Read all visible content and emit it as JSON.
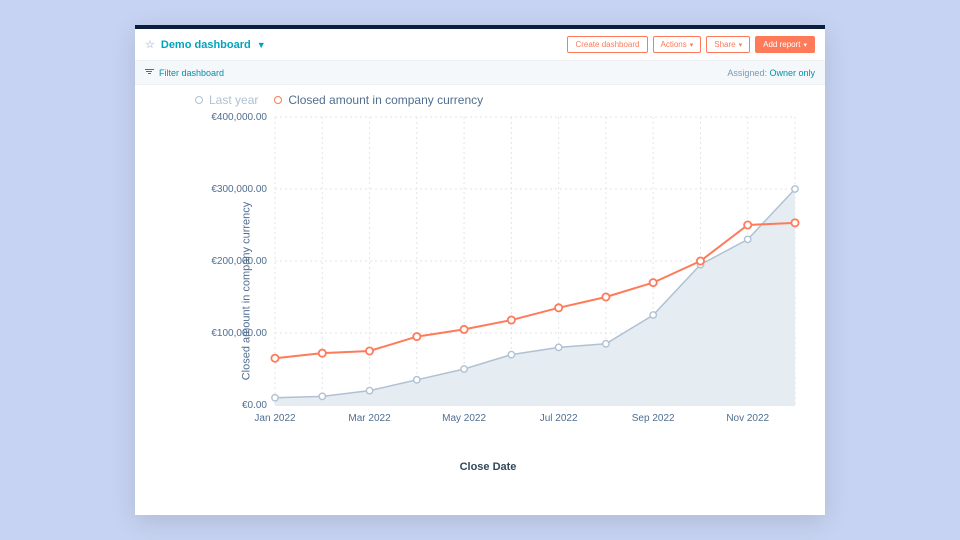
{
  "header": {
    "title": "Demo dashboard",
    "buttons": {
      "create": "Create dashboard",
      "actions": "Actions",
      "share": "Share",
      "add_report": "Add report"
    }
  },
  "filter_bar": {
    "filter_label": "Filter dashboard",
    "assigned_label": "Assigned:",
    "assigned_value": "Owner only"
  },
  "legend": {
    "series_a": "Last year",
    "series_b": "Closed amount in company currency"
  },
  "axes": {
    "ylabel": "Closed amount in company currency",
    "xlabel": "Close Date",
    "yticks": [
      "€0.00",
      "€100,000.00",
      "€200,000.00",
      "€300,000.00",
      "€400,000.00"
    ],
    "xticks": [
      "Jan 2022",
      "Mar 2022",
      "May 2022",
      "Jul 2022",
      "Sep 2022",
      "Nov 2022"
    ]
  },
  "chart_data": {
    "type": "line",
    "x": [
      "Jan 2022",
      "Feb 2022",
      "Mar 2022",
      "Apr 2022",
      "May 2022",
      "Jun 2022",
      "Jul 2022",
      "Aug 2022",
      "Sep 2022",
      "Oct 2022",
      "Nov 2022",
      "Dec 2022"
    ],
    "series": [
      {
        "name": "Last year",
        "values": [
          10000,
          12000,
          20000,
          35000,
          50000,
          70000,
          80000,
          85000,
          125000,
          195000,
          230000,
          300000
        ],
        "fill_area": true,
        "color": "#b0c1d4"
      },
      {
        "name": "Closed amount in company currency",
        "values": [
          65000,
          72000,
          75000,
          95000,
          105000,
          118000,
          135000,
          150000,
          170000,
          200000,
          250000,
          253000
        ],
        "color": "#ff7a59"
      }
    ],
    "xlabel": "Close Date",
    "ylabel": "Closed amount in company currency",
    "ylim": [
      0,
      400000
    ],
    "currency": "EUR"
  }
}
